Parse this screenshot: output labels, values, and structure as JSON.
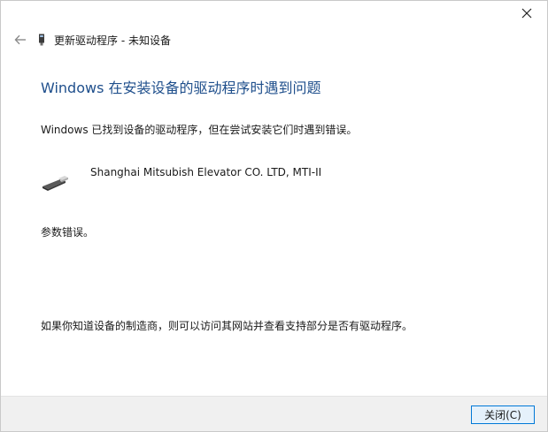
{
  "window": {
    "close_icon": "close-x-icon"
  },
  "header": {
    "back_icon": "back-arrow-icon",
    "device_icon": "device-small-icon",
    "title": "更新驱动程序 - 未知设备"
  },
  "main": {
    "heading": "Windows 在安装设备的驱动程序时遇到问题",
    "message": "Windows 已找到设备的驱动程序，但在尝试安装它们时遇到错误。",
    "device": {
      "icon": "usb-device-icon",
      "name": "Shanghai Mitsubish Elevator CO. LTD, MTI-II"
    },
    "error_detail": "参数错误。",
    "help_text": "如果你知道设备的制造商，则可以访问其网站并查看支持部分是否有驱动程序。"
  },
  "footer": {
    "close_label": "关闭(C)"
  },
  "colors": {
    "heading": "#1f4f8c",
    "button_border": "#0078d7",
    "button_bg": "#e5f1fb",
    "footer_bg": "#f0f0f0"
  }
}
